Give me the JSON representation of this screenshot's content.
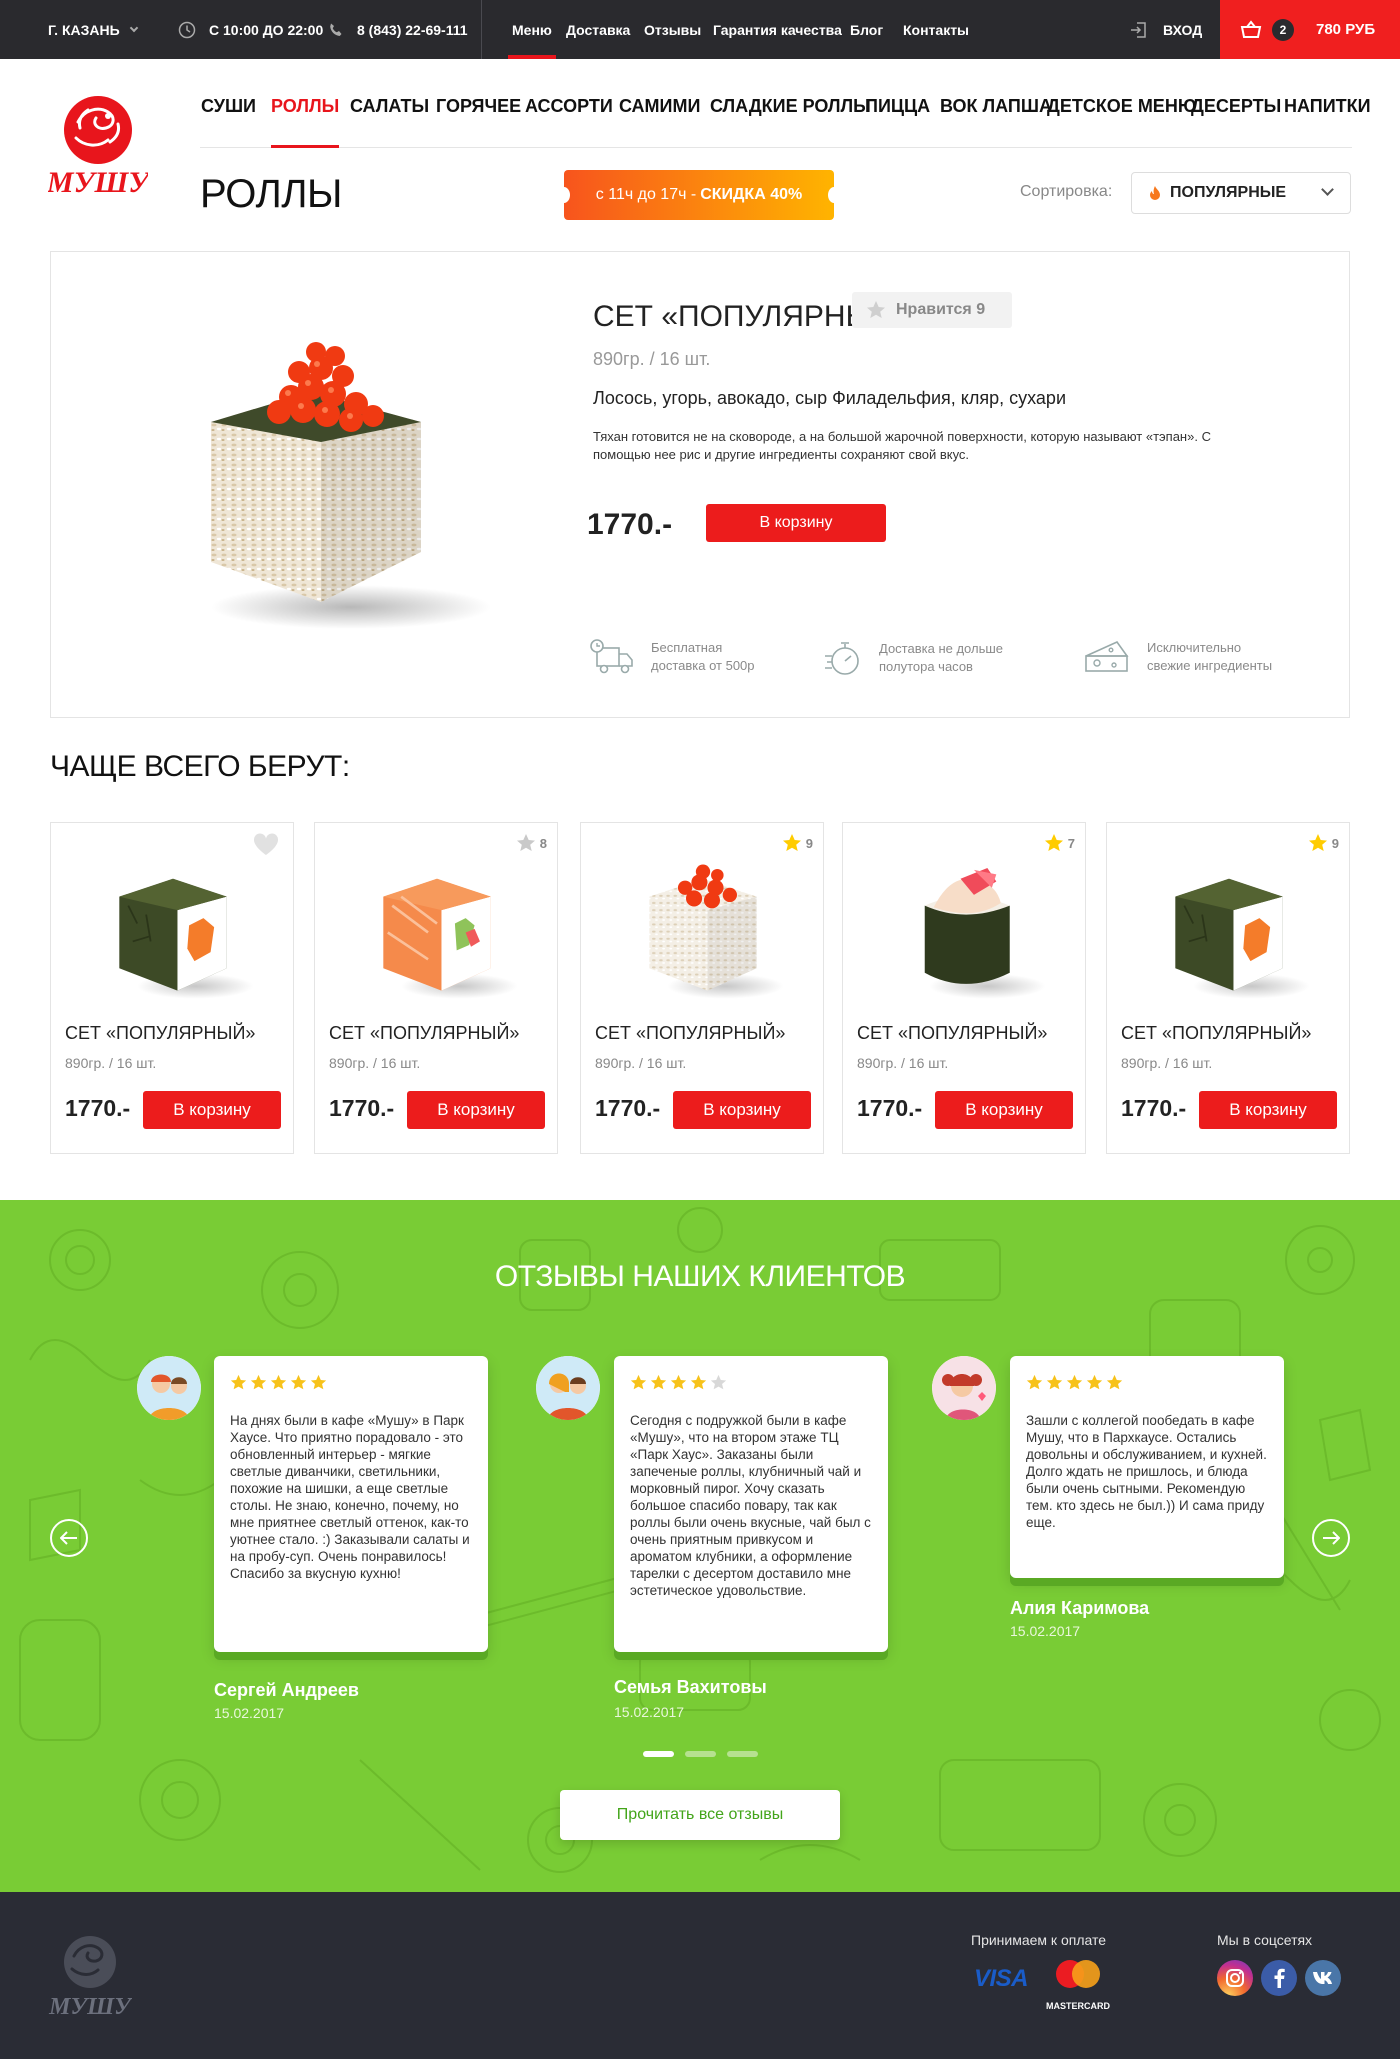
{
  "topbar": {
    "city": "Г. Казань",
    "hours": "С 10:00 ДО 22:00",
    "phone": "8 (843) 22-69-111",
    "nav": [
      "Меню",
      "Доставка",
      "Отзывы",
      "Гарантия качества",
      "Блог",
      "Контакты"
    ],
    "active_nav": "Меню",
    "login": "Вход",
    "cart_count": "2",
    "cart_total": "780 РУБ"
  },
  "brand": {
    "logo_text": "МУШУ",
    "accent": "#e8151c",
    "green": "#79cc35",
    "dark": "#2a2a2e"
  },
  "categories": [
    "Суши",
    "Роллы",
    "Салаты",
    "Горячее",
    "Ассорти",
    "Самими",
    "Сладкие роллы",
    "Пицца",
    "Вок лапша",
    "Детское меню",
    "Десерты",
    "Напитки"
  ],
  "active_category": "Роллы",
  "page": {
    "title": "РОЛЛЫ",
    "promo_time": "с 11ч до 17ч -",
    "promo_discount": "СКИДКА 40%",
    "sort_label": "Сортировка:",
    "sort_value": "Популярные"
  },
  "product": {
    "name": "СЕТ «ПОПУЛЯРНЫЙ»",
    "likes": "Нравится 9",
    "weight": "890гр. / 16 шт.",
    "composition": "Лосось, угорь, авокадо, сыр Филадельфия, кляр, сухари",
    "description": "Тяхан готовится не на сковороде, а на большой жарочной поверхности, которую называют «тэпан». С помощью нее рис и другие ингредиенты сохраняют свой вкус.",
    "price": "1770.-",
    "cart_button": "В корзину",
    "features": [
      {
        "icon": "delivery-truck-icon",
        "line1": "Бесплатная",
        "line2": "доставка от 500р"
      },
      {
        "icon": "stopwatch-icon",
        "line1": "Доставка не дольше",
        "line2": "полутора часов"
      },
      {
        "icon": "cheese-icon",
        "line1": "Исключительно",
        "line2": "свежие ингредиенты"
      }
    ]
  },
  "popular": {
    "title": "ЧАЩЕ ВСЕГО БЕРУТ:",
    "items": [
      {
        "name": "СЕТ «ПОПУЛЯРНЫЙ»",
        "weight": "890гр. / 16 шт.",
        "price": "1770.-",
        "button": "В корзину",
        "badge": "",
        "badge_icon": "heart-icon"
      },
      {
        "name": "СЕТ «ПОПУЛЯРНЫЙ»",
        "weight": "890гр. / 16 шт.",
        "price": "1770.-",
        "button": "В корзину",
        "badge": "8",
        "badge_icon": "star-gray-icon"
      },
      {
        "name": "СЕТ «ПОПУЛЯРНЫЙ»",
        "weight": "890гр. / 16 шт.",
        "price": "1770.-",
        "button": "В корзину",
        "badge": "9",
        "badge_icon": "star-yellow-icon"
      },
      {
        "name": "СЕТ «ПОПУЛЯРНЫЙ»",
        "weight": "890гр. / 16 шт.",
        "price": "1770.-",
        "button": "В корзину",
        "badge": "7",
        "badge_icon": "star-yellow-icon"
      },
      {
        "name": "СЕТ «ПОПУЛЯРНЫЙ»",
        "weight": "890гр. / 16 шт.",
        "price": "1770.-",
        "button": "В корзину",
        "badge": "9",
        "badge_icon": "star-yellow-icon"
      }
    ]
  },
  "reviews": {
    "title": "ОТЗЫВЫ НАШИХ КЛИЕНТОВ",
    "items": [
      {
        "stars": 5,
        "text": "На днях были в кафе «Мушу» в Парк Хаусе. Что приятно порадовало - это обновленный интерьер - мягкие светлые диванчики, светильники, похожие на шишки, а еще светлые столы. Не знаю, конечно, почему, но мне приятнее светлый оттенок, как-то уютнее стало. :) Заказывали салаты и на пробу-суп. Очень понравилось! Спасибо за вкусную кухню!",
        "name": "Сергей Андреев",
        "date": "15.02.2017"
      },
      {
        "stars": 4,
        "text": "Сегодня с подружкой были в кафе «Мушу», что на втором этаже ТЦ «Парк Хаус». Заказаны были запеченые роллы, клубничный чай и морковный пирог. Хочу сказать большое спасибо повару, так как роллы были очень вкусные, чай был с очень приятным привкусом и ароматом клубники, а оформление тарелки с десертом доставило мне эстетическое удовольствие.",
        "name": "Семья Вахитовы",
        "date": "15.02.2017"
      },
      {
        "stars": 5,
        "text": "Зашли с коллегой пообедать в кафе Мушу, что в Пархкаусе. Остались довольны и обслуживанием, и кухней. Долго ждать не пришлось, и блюда были очень сытными. Рекомендую тем. кто здесь не был.)) И сама приду еще.",
        "name": "Алия Каримова",
        "date": "15.02.2017"
      }
    ],
    "read_all": "Прочитать все отзывы"
  },
  "footer": {
    "logo_text": "МУШУ",
    "payment_label": "Принимаем к оплате",
    "visa": "VISA",
    "mastercard": "MASTERCARD",
    "social_label": "Мы в соцсетях",
    "social": [
      "instagram-icon",
      "facebook-icon",
      "vk-icon"
    ]
  }
}
